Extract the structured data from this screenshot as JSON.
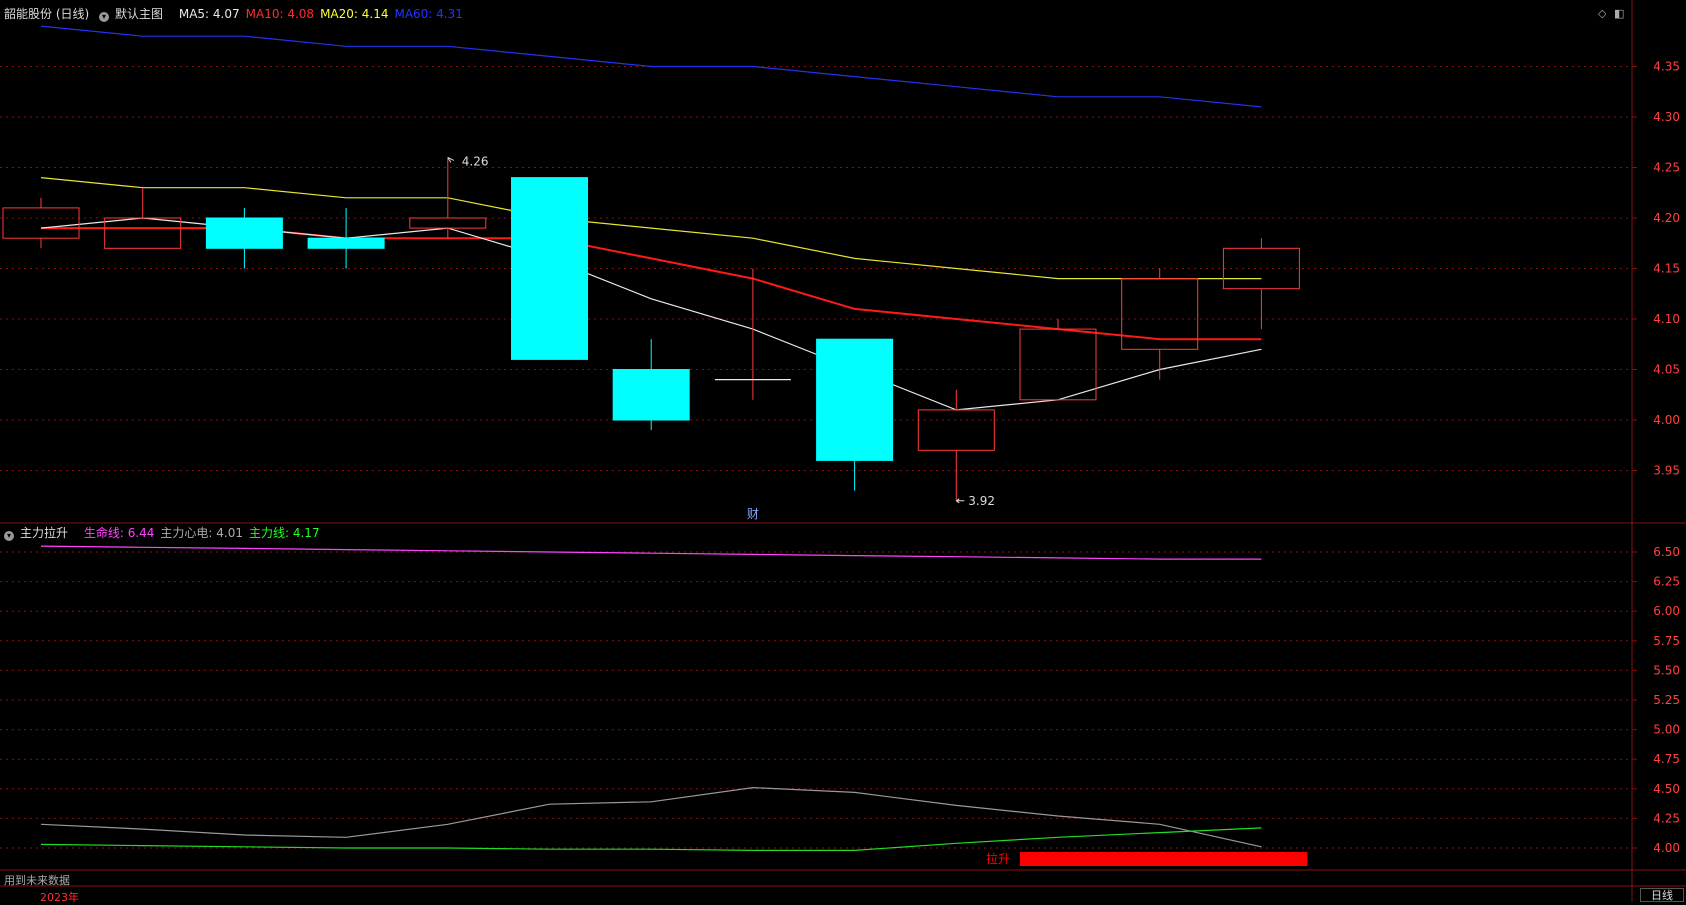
{
  "header": {
    "stock": "韶能股份 (日线)",
    "template_label": "默认主图",
    "ma": [
      {
        "label": "MA5:",
        "value": "4.07",
        "color": "#e8e8e8"
      },
      {
        "label": "MA10:",
        "value": "4.08",
        "color": "#ff2a2a"
      },
      {
        "label": "MA20:",
        "value": "4.14",
        "color": "#ffff33"
      },
      {
        "label": "MA60:",
        "value": "4.31",
        "color": "#2233ff"
      }
    ]
  },
  "indicator": {
    "name": "主力拉升",
    "lines": [
      {
        "label": "生命线:",
        "value": "6.44",
        "color": "#ff44ff"
      },
      {
        "label": "主力心电:",
        "value": "4.01",
        "color": "#aaaaaa"
      },
      {
        "label": "主力线:",
        "value": "4.17",
        "color": "#22ff22"
      }
    ],
    "signal_label": "拉升"
  },
  "footer": {
    "future_data_text": "用到未来数据",
    "year_label": "2023年",
    "period_button": "日线"
  },
  "annotations": {
    "high": "4.26",
    "low": "3.92",
    "finance_marker": "财"
  },
  "colors": {
    "up": "#ff3b3b",
    "down": "#00ffff",
    "grid": "#8a1010",
    "axis_text": "#ff4040",
    "ma5": "#e8e8e8",
    "ma10": "#ff1a1a",
    "ma20": "#e6e633",
    "ma60": "#2233ee",
    "life": "#ff44ff",
    "pulse": "#999999",
    "main": "#22dd22",
    "signal": "#ff0000"
  },
  "chart_data": [
    {
      "type": "candlestick",
      "title": "韶能股份 (日线)",
      "ylim": [
        3.9,
        4.4
      ],
      "yticks": [
        "4.35",
        "4.30",
        "4.25",
        "4.20",
        "4.15",
        "4.10",
        "4.05",
        "4.00",
        "3.95"
      ],
      "candles": [
        {
          "o": 4.18,
          "h": 4.22,
          "l": 4.17,
          "c": 4.21
        },
        {
          "o": 4.17,
          "h": 4.23,
          "l": 4.17,
          "c": 4.2
        },
        {
          "o": 4.2,
          "h": 4.21,
          "l": 4.15,
          "c": 4.17
        },
        {
          "o": 4.18,
          "h": 4.21,
          "l": 4.15,
          "c": 4.17
        },
        {
          "o": 4.19,
          "h": 4.26,
          "l": 4.18,
          "c": 4.2
        },
        {
          "o": 4.24,
          "h": 4.24,
          "l": 4.06,
          "c": 4.06
        },
        {
          "o": 4.05,
          "h": 4.08,
          "l": 3.99,
          "c": 4.0
        },
        {
          "o": 4.04,
          "h": 4.15,
          "l": 4.02,
          "c": 4.04
        },
        {
          "o": 4.08,
          "h": 4.08,
          "l": 3.93,
          "c": 3.96
        },
        {
          "o": 3.97,
          "h": 4.03,
          "l": 3.92,
          "c": 4.01
        },
        {
          "o": 4.02,
          "h": 4.1,
          "l": 4.02,
          "c": 4.09
        },
        {
          "o": 4.07,
          "h": 4.15,
          "l": 4.04,
          "c": 4.14
        },
        {
          "o": 4.13,
          "h": 4.18,
          "l": 4.09,
          "c": 4.17
        }
      ],
      "ma": {
        "MA5": [
          4.19,
          4.2,
          4.19,
          4.18,
          4.19,
          4.16,
          4.12,
          4.09,
          4.05,
          4.01,
          4.02,
          4.05,
          4.07
        ],
        "MA10": [
          4.19,
          4.19,
          4.19,
          4.18,
          4.18,
          4.18,
          4.16,
          4.14,
          4.11,
          4.1,
          4.09,
          4.08,
          4.08
        ],
        "MA20": [
          4.24,
          4.23,
          4.23,
          4.22,
          4.22,
          4.2,
          4.19,
          4.18,
          4.16,
          4.15,
          4.14,
          4.14,
          4.14
        ],
        "MA60": [
          4.39,
          4.38,
          4.38,
          4.37,
          4.37,
          4.36,
          4.35,
          4.35,
          4.34,
          4.33,
          4.32,
          4.32,
          4.31
        ]
      },
      "high_index": 4,
      "low_index": 9,
      "finance_index": 7
    },
    {
      "type": "line",
      "title": "主力拉升",
      "ylim": [
        3.9,
        6.7
      ],
      "yticks": [
        "6.50",
        "6.25",
        "6.00",
        "5.75",
        "5.50",
        "5.25",
        "5.00",
        "4.75",
        "4.50",
        "4.25",
        "4.00"
      ],
      "series": [
        {
          "name": "生命线",
          "values": [
            6.55,
            6.54,
            6.53,
            6.52,
            6.51,
            6.5,
            6.49,
            6.48,
            6.47,
            6.46,
            6.45,
            6.44,
            6.44
          ]
        },
        {
          "name": "主力心电",
          "values": [
            4.2,
            4.16,
            4.11,
            4.09,
            4.2,
            4.37,
            4.39,
            4.51,
            4.47,
            4.36,
            4.27,
            4.2,
            4.01
          ]
        },
        {
          "name": "主力线",
          "values": [
            4.03,
            4.02,
            4.01,
            4.0,
            4.0,
            3.99,
            3.99,
            3.98,
            3.98,
            4.04,
            4.09,
            4.13,
            4.17
          ]
        }
      ],
      "signal_start_index": 10
    }
  ]
}
